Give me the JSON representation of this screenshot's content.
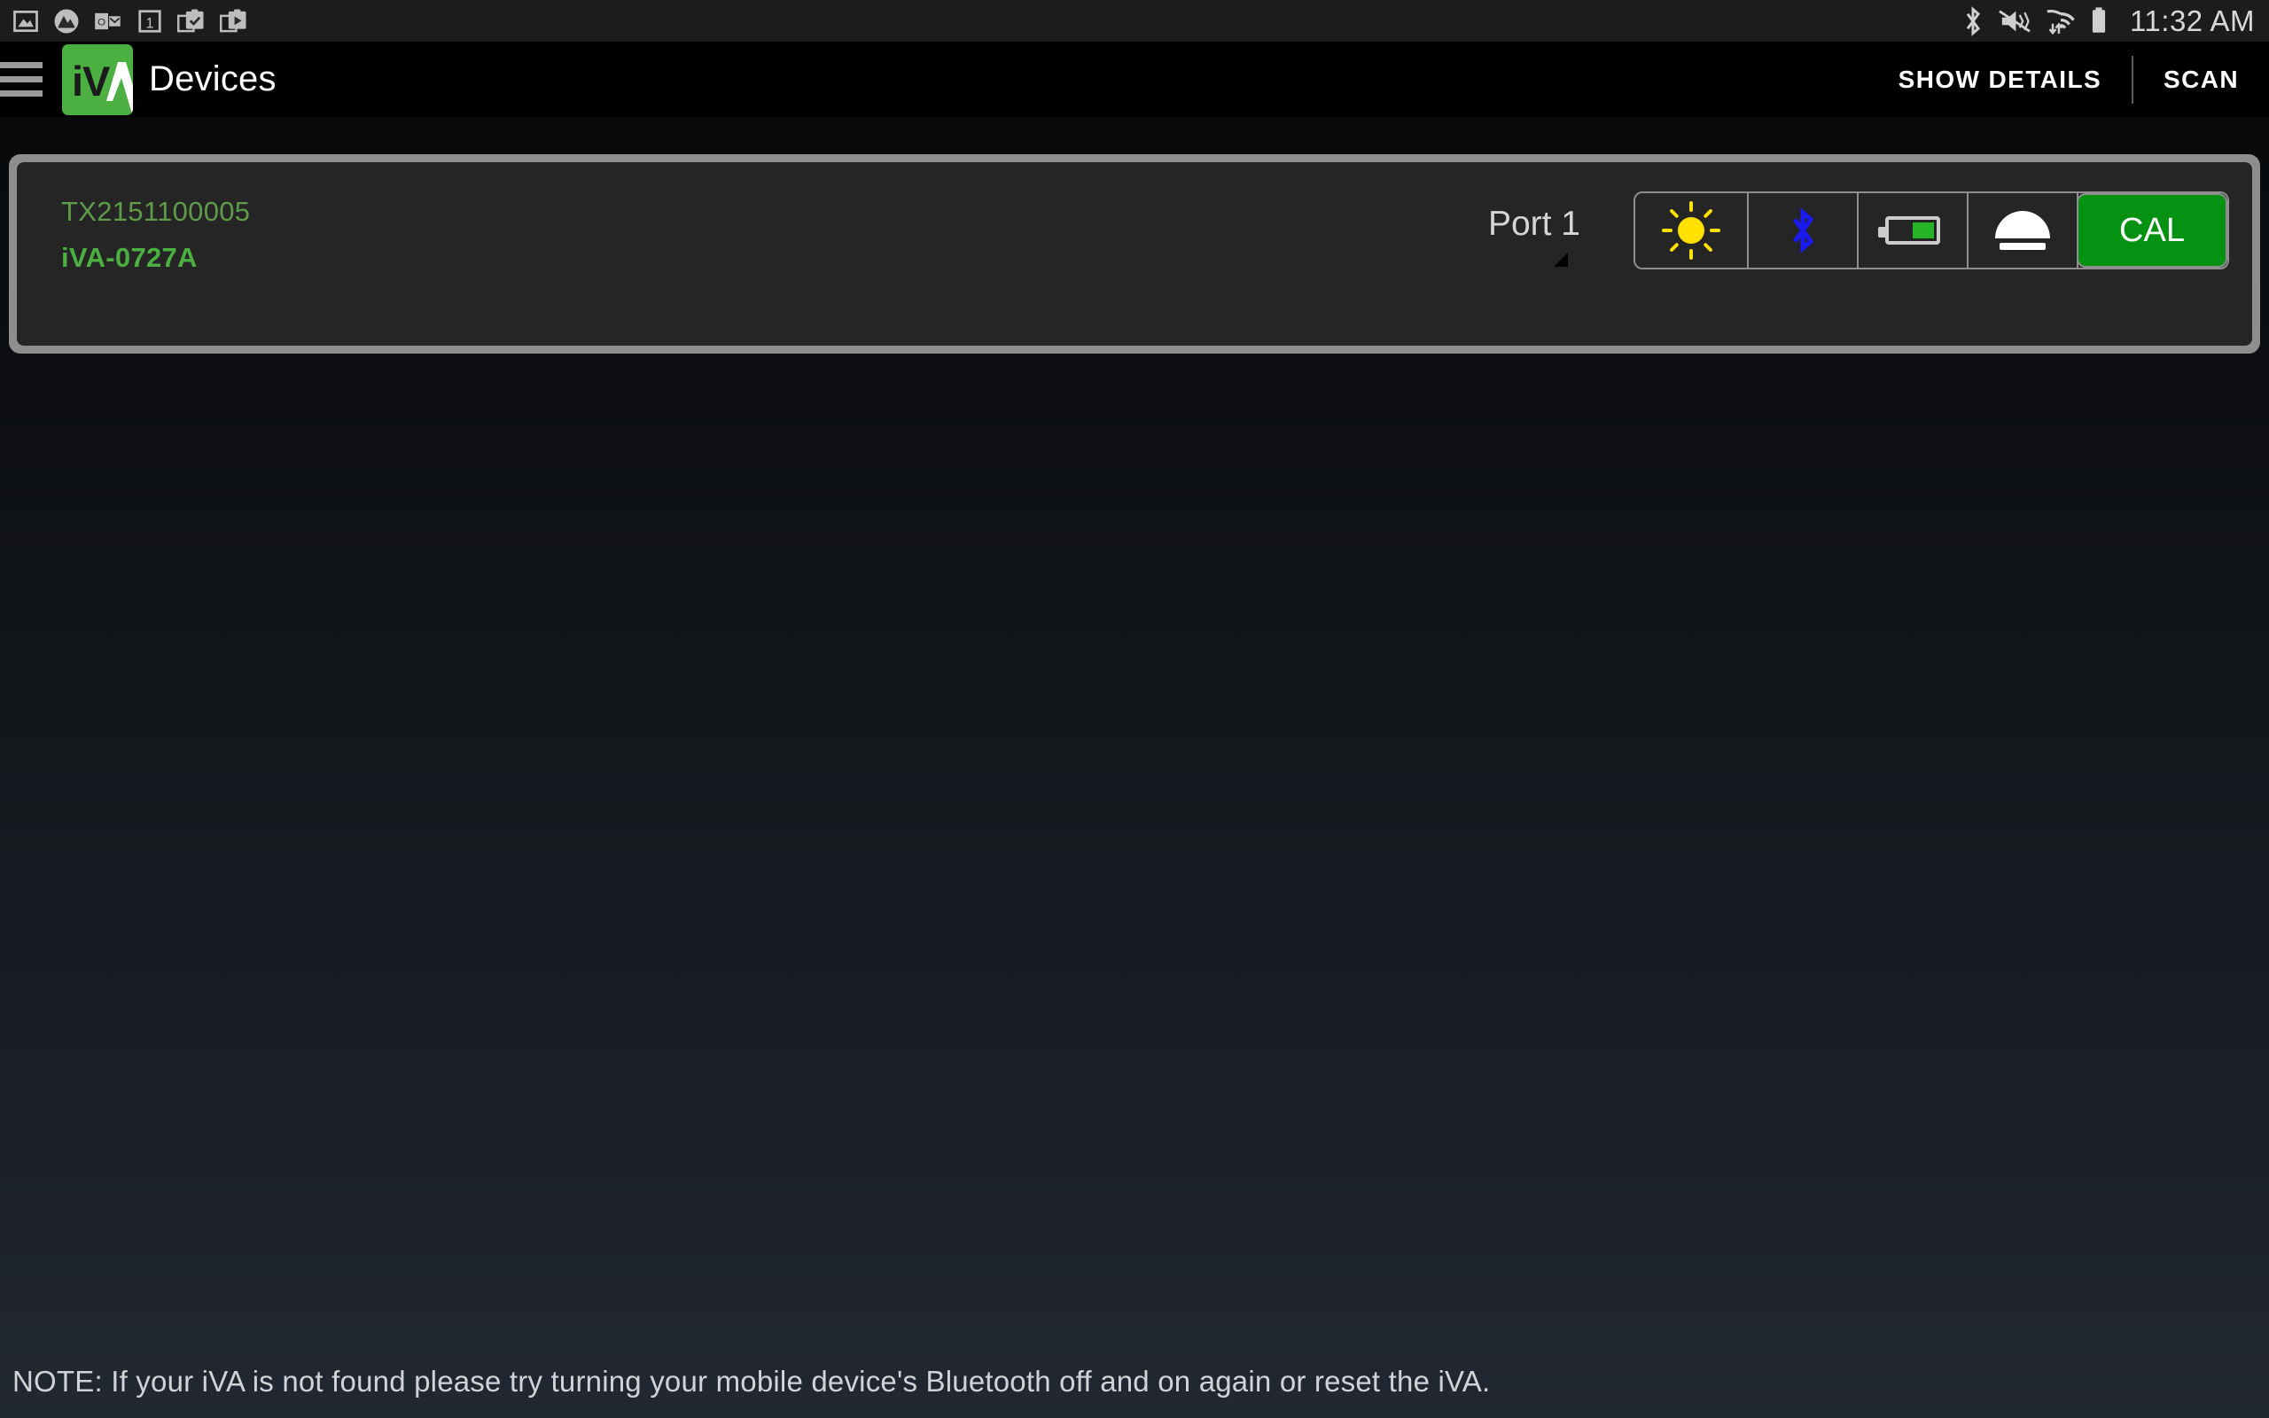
{
  "statusbar": {
    "clock": "11:32 AM",
    "left_icons": [
      {
        "name": "photo-gallery-icon"
      },
      {
        "name": "mountain-app-icon"
      },
      {
        "name": "outlook-icon"
      },
      {
        "name": "calendar-one-icon"
      },
      {
        "name": "task-check-icon"
      },
      {
        "name": "task-play-icon"
      }
    ],
    "right_icons": [
      {
        "name": "bluetooth-icon"
      },
      {
        "name": "vibrate-mute-icon"
      },
      {
        "name": "wifi-icon"
      },
      {
        "name": "battery-icon"
      }
    ]
  },
  "appbar": {
    "menu_label": "menu",
    "logo_text_dark": "iV",
    "logo_text_light": "Λ",
    "title": "Devices",
    "show_details_label": "SHOW DETAILS",
    "scan_label": "SCAN"
  },
  "device_card": {
    "serial": "TX2151100005",
    "model": "iVA-0727A",
    "port_label": "Port 1",
    "icons": [
      {
        "name": "sun-icon",
        "state": "active",
        "color": "#ffe000"
      },
      {
        "name": "bluetooth-icon",
        "state": "connected",
        "color": "#1a1aee"
      },
      {
        "name": "battery-icon",
        "state": "half",
        "color": "#27b327"
      },
      {
        "name": "dome-sensor-icon",
        "state": "on",
        "color": "#ffffff"
      }
    ],
    "cal_label": "CAL",
    "cal_color": "#059212"
  },
  "footer": {
    "note": "NOTE: If your iVA is not found please try turning your mobile device's Bluetooth off and on again or reset the iVA."
  },
  "colors": {
    "brand_green": "#4caf42",
    "serial_green": "#5f9b4a",
    "card_border": "#8e8e8e",
    "card_bg": "#252525",
    "statusbar_bg": "#1c1c1c"
  }
}
